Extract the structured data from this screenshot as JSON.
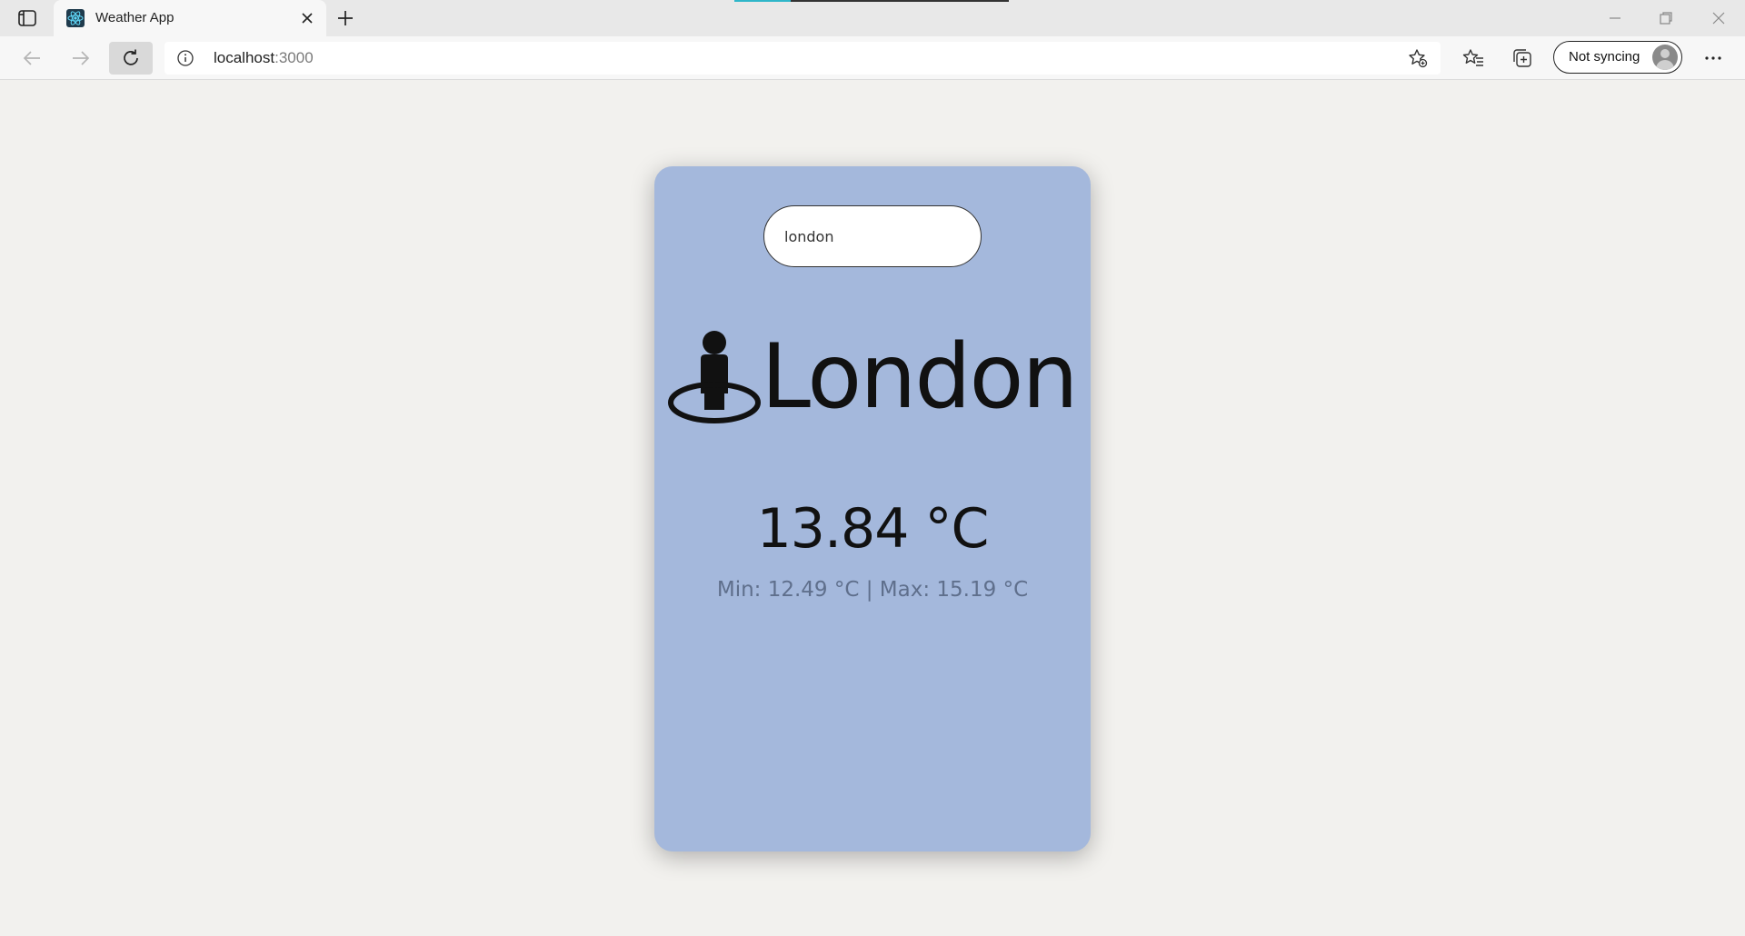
{
  "browser": {
    "tab_title": "Weather App",
    "url_host": "localhost",
    "url_port": ":3000",
    "sync_label": "Not syncing"
  },
  "search": {
    "value": "london"
  },
  "weather": {
    "city": "London",
    "temperature": "13.84 °C",
    "min_max": "Min: 12.49 °C | Max: 15.19 °C"
  },
  "colors": {
    "card_background": "#a4b8dc",
    "page_background": "#f2f1ee"
  },
  "icons": {
    "city_icon": "person-on-location-pin-icon",
    "favicon": "react-logo-icon"
  }
}
